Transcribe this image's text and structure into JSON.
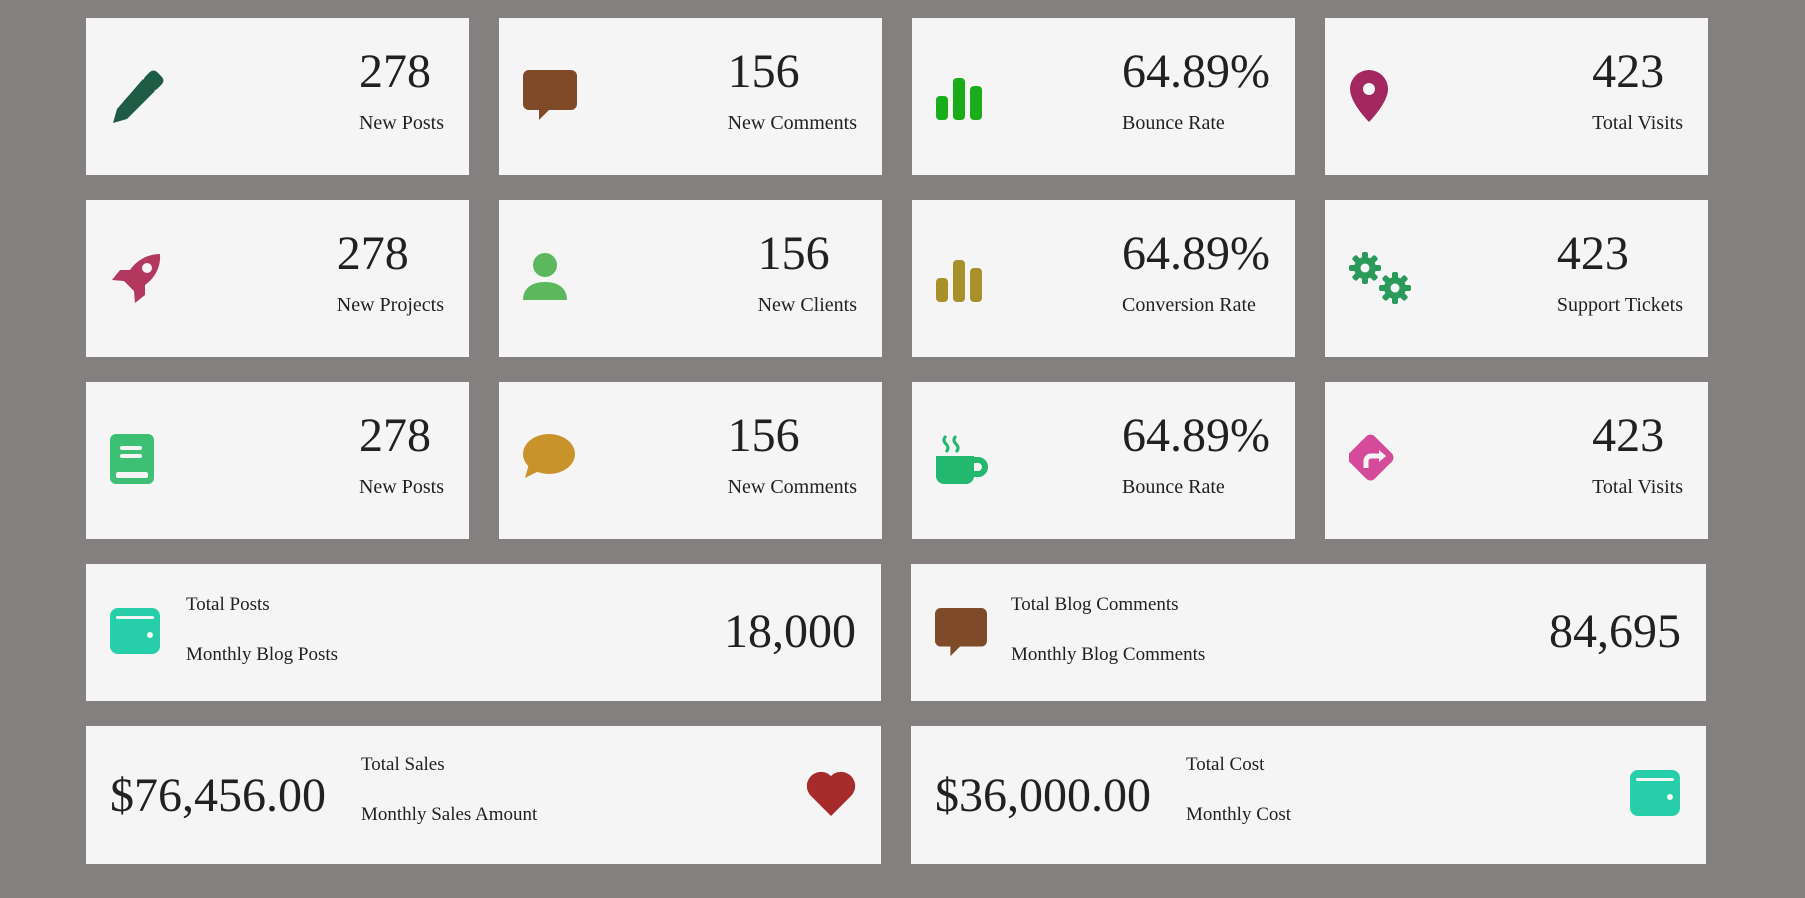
{
  "stats": [
    {
      "value": "278",
      "label": "New Posts",
      "icon": "pencil-icon",
      "color": "#1e5c45"
    },
    {
      "value": "156",
      "label": "New Comments",
      "icon": "comment-icon",
      "color": "#7f4a27"
    },
    {
      "value": "64.89%",
      "label": "Bounce Rate",
      "icon": "bar-chart-icon",
      "color": "#1aad1a"
    },
    {
      "value": "423",
      "label": "Total Visits",
      "icon": "map-marker-icon",
      "color": "#a3285f"
    },
    {
      "value": "278",
      "label": "New Projects",
      "icon": "rocket-icon",
      "color": "#b3385f"
    },
    {
      "value": "156",
      "label": "New Clients",
      "icon": "user-icon",
      "color": "#5cb85c"
    },
    {
      "value": "64.89%",
      "label": "Conversion Rate",
      "icon": "bar-chart-icon",
      "color": "#a8902a"
    },
    {
      "value": "423",
      "label": "Support Tickets",
      "icon": "cogs-icon",
      "color": "#2a9a5a"
    },
    {
      "value": "278",
      "label": "New Posts",
      "icon": "book-icon",
      "color": "#3dbf74"
    },
    {
      "value": "156",
      "label": "New Comments",
      "icon": "comment-bubble-icon",
      "color": "#c9932b"
    },
    {
      "value": "64.89%",
      "label": "Bounce Rate",
      "icon": "coffee-icon",
      "color": "#22b86e"
    },
    {
      "value": "423",
      "label": "Total Visits",
      "icon": "directions-icon",
      "color": "#d64a9a"
    }
  ],
  "summary": [
    {
      "title": "Total Posts",
      "subtitle": "Monthly Blog Posts",
      "value": "18,000",
      "icon": "wallet-icon",
      "color": "#26ceaa"
    },
    {
      "title": "Total Blog Comments",
      "subtitle": "Monthly Blog Comments",
      "value": "84,695",
      "icon": "comment-icon",
      "color": "#7f4a27"
    }
  ],
  "money": [
    {
      "value": "$76,456.00",
      "title": "Total Sales",
      "subtitle": "Monthly Sales Amount",
      "icon": "heart-icon",
      "color": "#a82b2b"
    },
    {
      "value": "$36,000.00",
      "title": "Total Cost",
      "subtitle": "Monthly Cost",
      "icon": "wallet-icon",
      "color": "#26ceaa"
    }
  ]
}
